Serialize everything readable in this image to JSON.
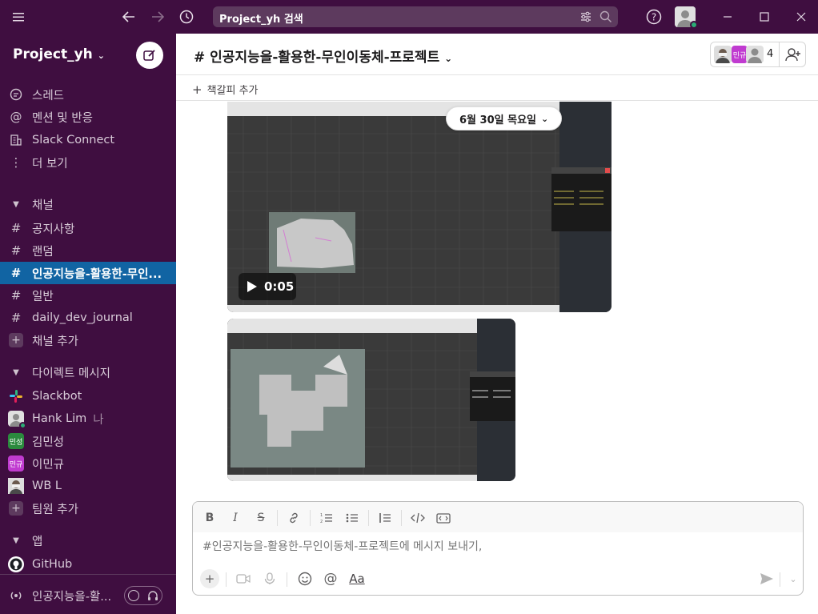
{
  "search": {
    "text": "Project_yh 검색"
  },
  "workspace": {
    "name": "Project_yh"
  },
  "sidebar": {
    "nav": [
      {
        "label": "스레드",
        "icon": "threads-icon"
      },
      {
        "label": "멘션 및 반응",
        "icon": "at-icon"
      },
      {
        "label": "Slack Connect",
        "icon": "building-icon"
      },
      {
        "label": "더 보기",
        "icon": "more-icon"
      }
    ],
    "channels_header": "채널",
    "channels": [
      {
        "label": "공지사항"
      },
      {
        "label": "랜덤"
      },
      {
        "label": "인공지능을-활용한-무인..."
      },
      {
        "label": "일반"
      },
      {
        "label": "daily_dev_journal"
      }
    ],
    "add_channel": "채널 추가",
    "dm_header": "다이렉트 메시지",
    "dms": [
      {
        "label": "Slackbot",
        "avatar": "slackbot"
      },
      {
        "label": "Hank Lim",
        "suffix": "나"
      },
      {
        "label": "김민성",
        "avatar_text": "민성"
      },
      {
        "label": "이민규",
        "avatar_text": "민규"
      },
      {
        "label": "WB L"
      }
    ],
    "add_member": "팀원 추가",
    "apps_header": "앱",
    "apps": [
      {
        "label": "GitHub"
      }
    ],
    "huddle": {
      "label": "인공지능을-활..."
    }
  },
  "channel": {
    "title": "# 인공지능을-활용한-무인이동체-프로젝트",
    "member_count": "4",
    "member_avatar_text": "민규",
    "bookmark_add": "책갈피 추가"
  },
  "messages": {
    "date_pill": "6월 30일 목요일",
    "video_duration": "0:05"
  },
  "composer": {
    "placeholder": "#인공지능을-활용한-무인이동체-프로젝트에 메시지 보내기,",
    "aa_label": "Aa"
  },
  "colors": {
    "sidebar": "#3f0e40",
    "active": "#1164a3",
    "presence": "#2bac76"
  }
}
